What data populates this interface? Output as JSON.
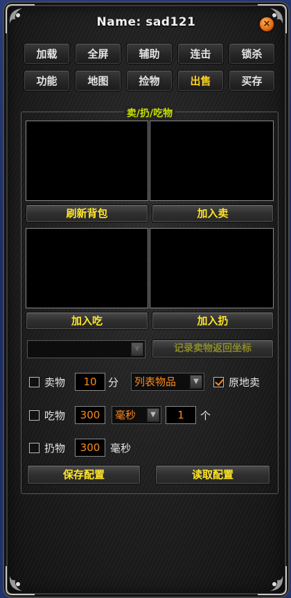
{
  "window": {
    "title": "Name: sad121",
    "close_symbol": "×"
  },
  "tabs": [
    {
      "label": "加载"
    },
    {
      "label": "全屏"
    },
    {
      "label": "辅助"
    },
    {
      "label": "连击"
    },
    {
      "label": "锁杀"
    },
    {
      "label": "功能"
    },
    {
      "label": "地图"
    },
    {
      "label": "捡物"
    },
    {
      "label": "出售",
      "active": true
    },
    {
      "label": "买存"
    }
  ],
  "group": {
    "title": "卖/扔/吃物",
    "refresh_label": "刷新背包",
    "add_sell_label": "加入卖",
    "add_eat_label": "加入吃",
    "add_throw_label": "加入扔",
    "record_label": "记录卖物返回坐标",
    "record_select_value": ""
  },
  "sell": {
    "label": "卖物",
    "checked": false,
    "interval": "10",
    "unit": "分",
    "mode": "列表物品",
    "in_place_label": "原地卖",
    "in_place_checked": true
  },
  "eat": {
    "label": "吃物",
    "checked": false,
    "interval": "300",
    "unit": "毫秒",
    "count": "1",
    "count_unit": "个"
  },
  "throw": {
    "label": "扔物",
    "checked": false,
    "interval": "300",
    "unit": "毫秒"
  },
  "config": {
    "save_label": "保存配置",
    "load_label": "读取配置"
  },
  "colors": {
    "accent_yellow": "#ffe626",
    "value_orange": "#ff8a1a",
    "active_tab": "#ffd21e",
    "group_title": "#c8e000"
  }
}
